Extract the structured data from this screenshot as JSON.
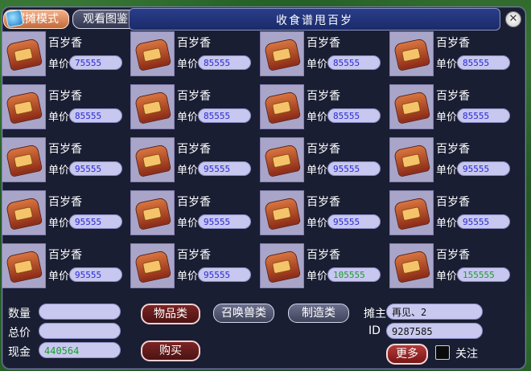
{
  "window": {
    "title": "收食谱甩百岁",
    "tabs": [
      {
        "label": "摆摊模式"
      },
      {
        "label": "观看图鉴"
      }
    ]
  },
  "items": [
    {
      "name": "百岁香",
      "price_label": "单价",
      "price": "75555"
    },
    {
      "name": "百岁香",
      "price_label": "单价",
      "price": "85555"
    },
    {
      "name": "百岁香",
      "price_label": "单价",
      "price": "85555"
    },
    {
      "name": "百岁香",
      "price_label": "单价",
      "price": "85555"
    },
    {
      "name": "百岁香",
      "price_label": "单价",
      "price": "85555"
    },
    {
      "name": "百岁香",
      "price_label": "单价",
      "price": "85555"
    },
    {
      "name": "百岁香",
      "price_label": "单价",
      "price": "85555"
    },
    {
      "name": "百岁香",
      "price_label": "单价",
      "price": "85555"
    },
    {
      "name": "百岁香",
      "price_label": "单价",
      "price": "95555"
    },
    {
      "name": "百岁香",
      "price_label": "单价",
      "price": "95555"
    },
    {
      "name": "百岁香",
      "price_label": "单价",
      "price": "95555"
    },
    {
      "name": "百岁香",
      "price_label": "单价",
      "price": "95555"
    },
    {
      "name": "百岁香",
      "price_label": "单价",
      "price": "95555"
    },
    {
      "name": "百岁香",
      "price_label": "单价",
      "price": "95555"
    },
    {
      "name": "百岁香",
      "price_label": "单价",
      "price": "95555"
    },
    {
      "name": "百岁香",
      "price_label": "单价",
      "price": "95555"
    },
    {
      "name": "百岁香",
      "price_label": "单价",
      "price": "95555"
    },
    {
      "name": "百岁香",
      "price_label": "单价",
      "price": "95555"
    },
    {
      "name": "百岁香",
      "price_label": "单价",
      "price": "105555"
    },
    {
      "name": "百岁香",
      "price_label": "单价",
      "price": "155555"
    }
  ],
  "bottom": {
    "quantity_label": "数量",
    "quantity_value": "",
    "total_label": "总价",
    "total_value": "",
    "cash_label": "现金",
    "cash_value": "440564",
    "owner_label": "摊主",
    "owner_value": "再见、2",
    "id_label": "ID",
    "id_value": "9287585",
    "category_buttons": [
      "物品类",
      "召唤兽类",
      "制造类"
    ],
    "buy_button": "购买",
    "more_button": "更多",
    "follow_label": "关注"
  }
}
